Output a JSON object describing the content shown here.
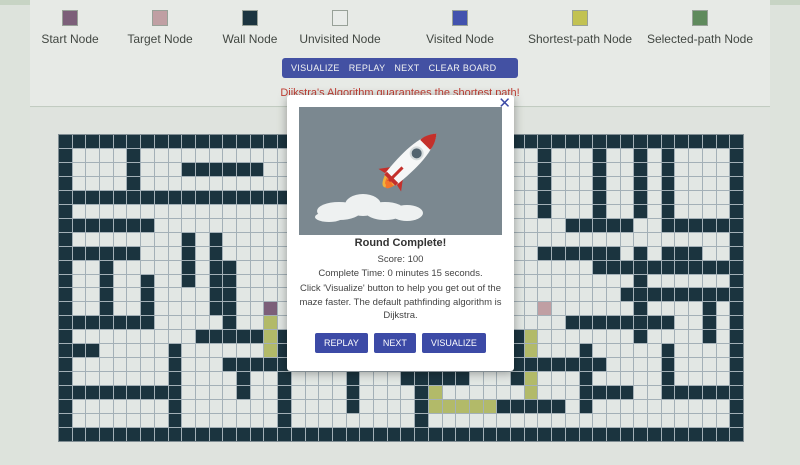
{
  "legend": [
    {
      "label": "Start Node",
      "color": "#7b5a78"
    },
    {
      "label": "Target Node",
      "color": "#c7a1a6"
    },
    {
      "label": "Wall Node",
      "color": "#0f2a37"
    },
    {
      "label": "Unvisited Node",
      "color": "#f4f6f4"
    },
    {
      "label": "Visited Node",
      "color": "#3a4bb3"
    },
    {
      "label": "Shortest-path Node",
      "color": "#c9c84c"
    },
    {
      "label": "Selected-path Node",
      "color": "#5b8a57"
    }
  ],
  "toolbar": {
    "visualize_label": "VISUALIZE",
    "replay_label": "REPLAY",
    "next_label": "NEXT",
    "clear_label": "CLEAR BOARD"
  },
  "status": "Dijkstra's Algorithm guarantees the shortest path!",
  "modal": {
    "close_glyph": "✕",
    "title": "Round Complete!",
    "score": "Score: 100",
    "time": "Complete Time: 0 minutes 15 seconds.",
    "message": "Click 'Visualize' button to help you get out of the maze faster. The default pathfinding algorithm is Dijkstra.",
    "replay_label": "REPLAY",
    "next_label": "NEXT",
    "visualize_label": "VISUALIZE",
    "image_icon": "rocket-icon"
  },
  "colors": {
    "accent": "#3c4aa6",
    "wall": "#0f2a37",
    "path": "#b7bf66",
    "start": "#7b5a78",
    "target": "#c7a1a6"
  }
}
